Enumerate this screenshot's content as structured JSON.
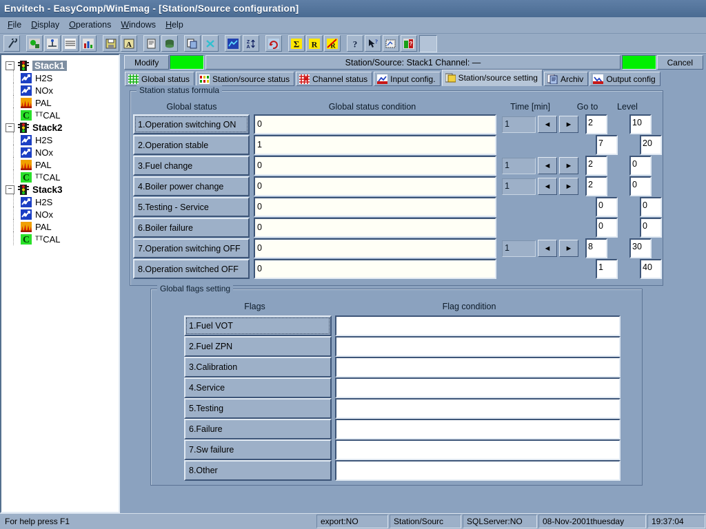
{
  "window": {
    "title": "Envitech  -  EasyComp/WinEmag  -  [Station/Source configuration]"
  },
  "menu": {
    "items": [
      {
        "label": "File",
        "accel": "F"
      },
      {
        "label": "Display",
        "accel": "D"
      },
      {
        "label": "Operations",
        "accel": "O"
      },
      {
        "label": "Windows",
        "accel": "W"
      },
      {
        "label": "Help",
        "accel": "H"
      }
    ]
  },
  "toolbar": {
    "buttons": [
      {
        "name": "measure-probe-icon",
        "glyph": "⸬"
      },
      {
        "name": "station-config-icon",
        "glyph": "⚙"
      },
      {
        "name": "channel-config-icon",
        "glyph": "⎈"
      },
      {
        "name": "data-table-icon",
        "glyph": "≣"
      },
      {
        "name": "bar-chart-icon",
        "glyph": "▐"
      },
      {
        "name": "save-icon",
        "glyph": "▣"
      },
      {
        "name": "font-icon",
        "glyph": "A"
      },
      {
        "name": "report-icon",
        "glyph": "▤"
      },
      {
        "name": "database-icon",
        "glyph": "●"
      },
      {
        "name": "copy-icon",
        "glyph": "⧉"
      },
      {
        "name": "close-x-icon",
        "glyph": "✕"
      },
      {
        "name": "graph-window-icon",
        "glyph": "▦"
      },
      {
        "name": "sort-az-icon",
        "glyph": "Z↕"
      },
      {
        "name": "refresh-icon",
        "glyph": "↻"
      },
      {
        "name": "sum-icon",
        "glyph": "Σ"
      },
      {
        "name": "r-value-icon",
        "glyph": "R"
      },
      {
        "name": "r-strike-icon",
        "glyph": "R"
      },
      {
        "name": "help-icon",
        "glyph": "?"
      },
      {
        "name": "context-help-icon",
        "glyph": "↖?"
      },
      {
        "name": "zoom-region-icon",
        "glyph": "◱"
      },
      {
        "name": "about-icon",
        "glyph": "⚑"
      }
    ]
  },
  "tree": {
    "stations": [
      {
        "label": "Stack1",
        "selected": true,
        "expanded": true,
        "icon": "traffic-light-icon",
        "children": [
          {
            "label": "H2S",
            "icon": "channel-blue-icon"
          },
          {
            "label": "NOx",
            "icon": "channel-blue-icon"
          },
          {
            "label": "PAL",
            "icon": "flame-orange-icon"
          },
          {
            "label": "ᵀᵀCAL",
            "icon": "calibration-green-icon"
          }
        ]
      },
      {
        "label": "Stack2",
        "selected": false,
        "expanded": true,
        "icon": "traffic-light-icon",
        "children": [
          {
            "label": "H2S",
            "icon": "channel-blue-icon"
          },
          {
            "label": "NOx",
            "icon": "channel-blue-icon"
          },
          {
            "label": "PAL",
            "icon": "flame-orange-icon"
          },
          {
            "label": "ᵀᵀCAL",
            "icon": "calibration-green-icon"
          }
        ]
      },
      {
        "label": "Stack3",
        "selected": false,
        "expanded": true,
        "icon": "traffic-light-icon",
        "children": [
          {
            "label": "H2S",
            "icon": "channel-blue-icon"
          },
          {
            "label": "NOx",
            "icon": "channel-blue-icon"
          },
          {
            "label": "PAL",
            "icon": "flame-orange-icon"
          },
          {
            "label": "ᵀᵀCAL",
            "icon": "calibration-green-icon"
          }
        ]
      }
    ]
  },
  "modifybar": {
    "modify_label": "Modify",
    "cancel_label": "Cancel",
    "title": "Station/Source: Stack1   Channel: —",
    "led_left_color": "#00ef00",
    "led_right_color": "#00ef00"
  },
  "tabs": [
    {
      "label": "Global status",
      "icon": "grid-green-icon",
      "active": false
    },
    {
      "label": "Station/source status",
      "icon": "status-multicolor-icon",
      "active": false
    },
    {
      "label": "Channel status",
      "icon": "grid-red-icon",
      "active": false
    },
    {
      "label": "Input config.",
      "icon": "input-config-icon",
      "active": false
    },
    {
      "label": "Station/source setting",
      "icon": "station-setting-icon",
      "active": true
    },
    {
      "label": "Archiv",
      "icon": "archive-icon",
      "active": false
    },
    {
      "label": "Output config",
      "icon": "output-config-icon",
      "active": false
    }
  ],
  "formula_group": {
    "legend": "Station status formula",
    "headers": {
      "global_status": "Global status",
      "condition": "Global status condition",
      "time": "Time [min]",
      "goto": "Go to",
      "level": "Level"
    },
    "rows": [
      {
        "label": "1.Operation switching ON",
        "condition": "0",
        "time": "1",
        "has_spin": true,
        "goto": "2",
        "level": "10",
        "focused": true
      },
      {
        "label": "2.Operation stable",
        "condition": "1",
        "time": "",
        "has_spin": false,
        "goto": "7",
        "level": "20",
        "focused": false
      },
      {
        "label": "3.Fuel change",
        "condition": "0",
        "time": "1",
        "has_spin": true,
        "goto": "2",
        "level": "0",
        "focused": false
      },
      {
        "label": "4.Boiler power change",
        "condition": "0",
        "time": "1",
        "has_spin": true,
        "goto": "2",
        "level": "0",
        "focused": false
      },
      {
        "label": "5.Testing - Service",
        "condition": "0",
        "time": "",
        "has_spin": false,
        "goto": "0",
        "level": "0",
        "focused": false
      },
      {
        "label": "6.Boiler failure",
        "condition": "0",
        "time": "",
        "has_spin": false,
        "goto": "0",
        "level": "0",
        "focused": false
      },
      {
        "label": "7.Operation switching OFF",
        "condition": "0",
        "time": "1",
        "has_spin": true,
        "goto": "8",
        "level": "30",
        "focused": false
      },
      {
        "label": "8.Operation switched OFF",
        "condition": "0",
        "time": "",
        "has_spin": false,
        "goto": "1",
        "level": "40",
        "focused": false
      }
    ],
    "spin_left": "◄",
    "spin_right": "►"
  },
  "flags_group": {
    "legend": "Global flags setting",
    "headers": {
      "flags": "Flags",
      "condition": "Flag condition"
    },
    "rows": [
      {
        "label": "1.Fuel VOT",
        "condition": "",
        "focused": true
      },
      {
        "label": "2.Fuel ZPN",
        "condition": "",
        "focused": false
      },
      {
        "label": "3.Calibration",
        "condition": "",
        "focused": false
      },
      {
        "label": "4.Service",
        "condition": "",
        "focused": false
      },
      {
        "label": "5.Testing",
        "condition": "",
        "focused": false
      },
      {
        "label": "6.Failure",
        "condition": "",
        "focused": false
      },
      {
        "label": "7.Sw failure",
        "condition": "",
        "focused": false
      },
      {
        "label": "8.Other",
        "condition": "",
        "focused": false
      }
    ]
  },
  "statusbar": {
    "help": "For help press F1",
    "export": "export:NO",
    "station": "Station/Sourc",
    "sqlserver": "SQLServer:NO",
    "date": "08-Nov-2001thuesday",
    "time": "19:37:04"
  }
}
